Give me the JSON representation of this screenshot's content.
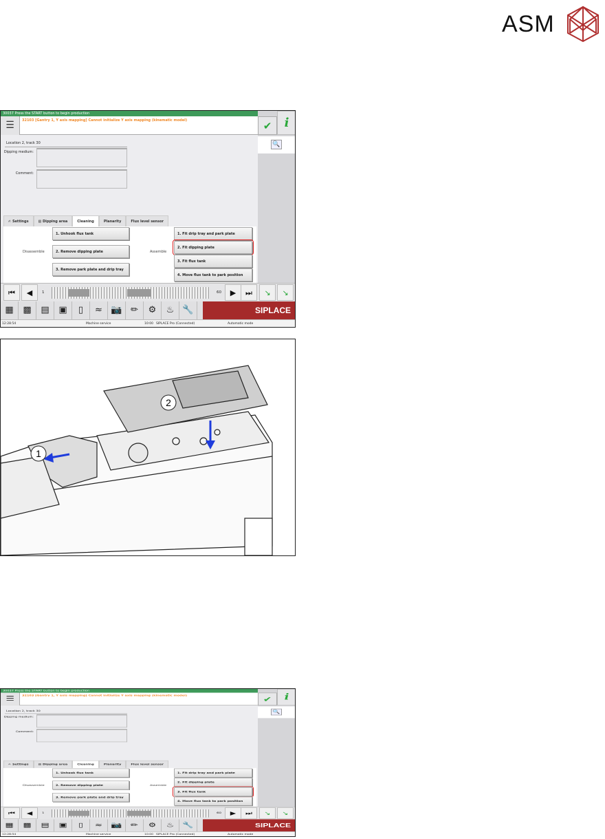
{
  "logo": {
    "text": "ASM",
    "color": "#b03030"
  },
  "screens": [
    {
      "header": "30037 Press the START button to begin production",
      "message": "32103 [Gantry 1, Y axis mapping] Cannot initialize Y axis mapping (kinematic model)",
      "location": "Location 2, track 30",
      "dipping_medium_label": "Dipping medium:",
      "comment_label": "Comment:",
      "tabs": [
        "Settings",
        "Dipping area",
        "Cleaning",
        "Planarity",
        "Flux level sensor"
      ],
      "active_tab": 2,
      "disassemble_label": "Disassemble",
      "assemble_label": "Assemble",
      "disassemble": [
        "1. Unhook flux tank",
        "2. Remove dipping plate",
        "3. Remove park plate and drip tray"
      ],
      "assemble": [
        "1. Fit drip tray and park plate",
        "2. Fit dipping plate",
        "3. Fit flux tank",
        "4. Move flux tank to park position"
      ],
      "highlighted_assemble": 1,
      "track_start": "1",
      "track_end": "60",
      "brand": "SIPLACE",
      "status": {
        "time": "12:28:54",
        "user": "Machine service",
        "clock": "10:00",
        "connection": "SIPLACE Pro (Connected)",
        "mode": "Automatic mode"
      }
    },
    {
      "header": "30037 Press the START button to begin production",
      "message": "32103 [Gantry 1, Y axis mapping] Cannot initialize Y axis mapping (kinematic model)",
      "location": "Location 2, track 30",
      "dipping_medium_label": "Dipping medium:",
      "comment_label": "Comment:",
      "tabs": [
        "Settings",
        "Dipping area",
        "Cleaning",
        "Planarity",
        "Flux level sensor"
      ],
      "active_tab": 2,
      "disassemble_label": "Disassemble",
      "assemble_label": "Assemble",
      "disassemble": [
        "1. Unhook flux tank",
        "2. Remove dipping plate",
        "3. Remove park plate and drip tray"
      ],
      "assemble": [
        "1. Fit drip tray and park plate",
        "2. Fit dipping plate",
        "3. Fit flux tank",
        "4. Move flux tank to park position"
      ],
      "highlighted_assemble": 2,
      "track_start": "1",
      "track_end": "60",
      "brand": "SIPLACE",
      "status": {
        "time": "12:28:54",
        "user": "Machine service",
        "clock": "10:00",
        "connection": "SIPLACE Pro (Connected)",
        "mode": "Automatic mode"
      }
    }
  ],
  "illustration": {
    "callouts": [
      "1",
      "2"
    ],
    "arrow_color": "#1e3cdc"
  }
}
